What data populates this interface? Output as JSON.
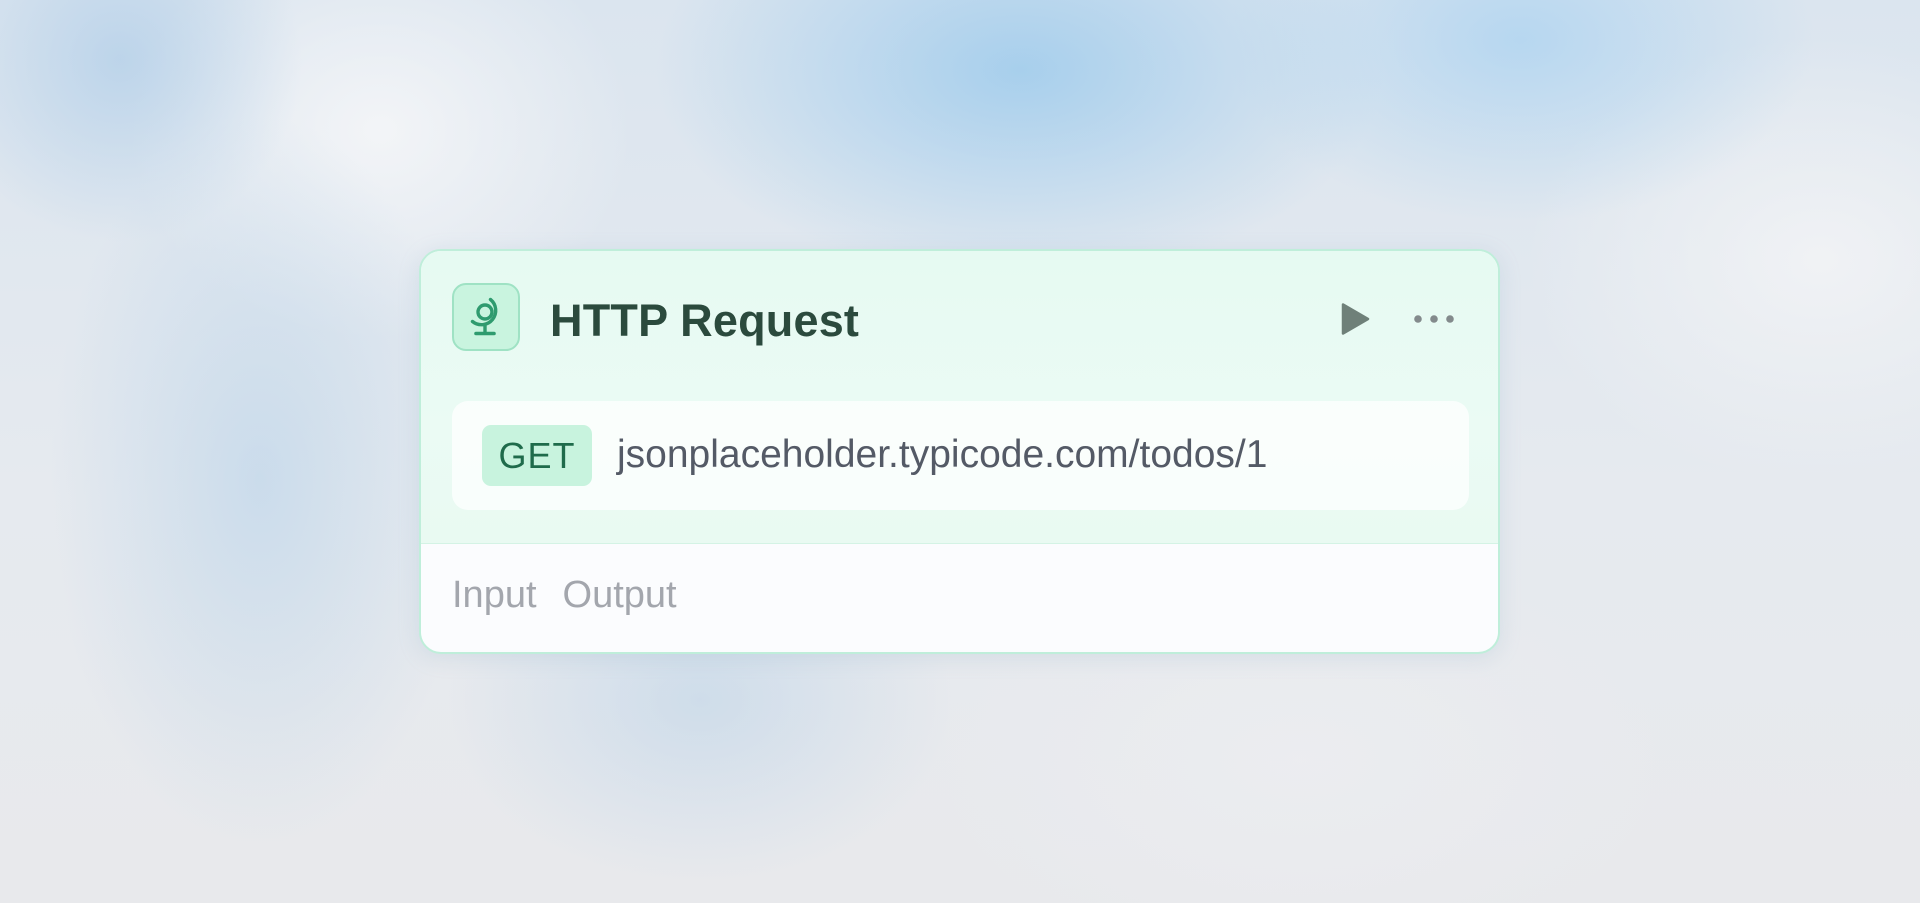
{
  "node": {
    "icon": "globe-icon",
    "title": "HTTP Request",
    "actions": {
      "run_icon": "play-icon",
      "more_icon": "more-horizontal-icon"
    },
    "request": {
      "method": "GET",
      "url": "jsonplaceholder.typicode.com/todos/1"
    },
    "tabs": [
      {
        "label": "Input"
      },
      {
        "label": "Output"
      }
    ]
  },
  "colors": {
    "accent": "#2f9b6f",
    "accent_light": "#c8f3de",
    "card_border": "#bfeeda",
    "title_text": "#2b4a3d",
    "muted_text": "#a3a6ad"
  }
}
